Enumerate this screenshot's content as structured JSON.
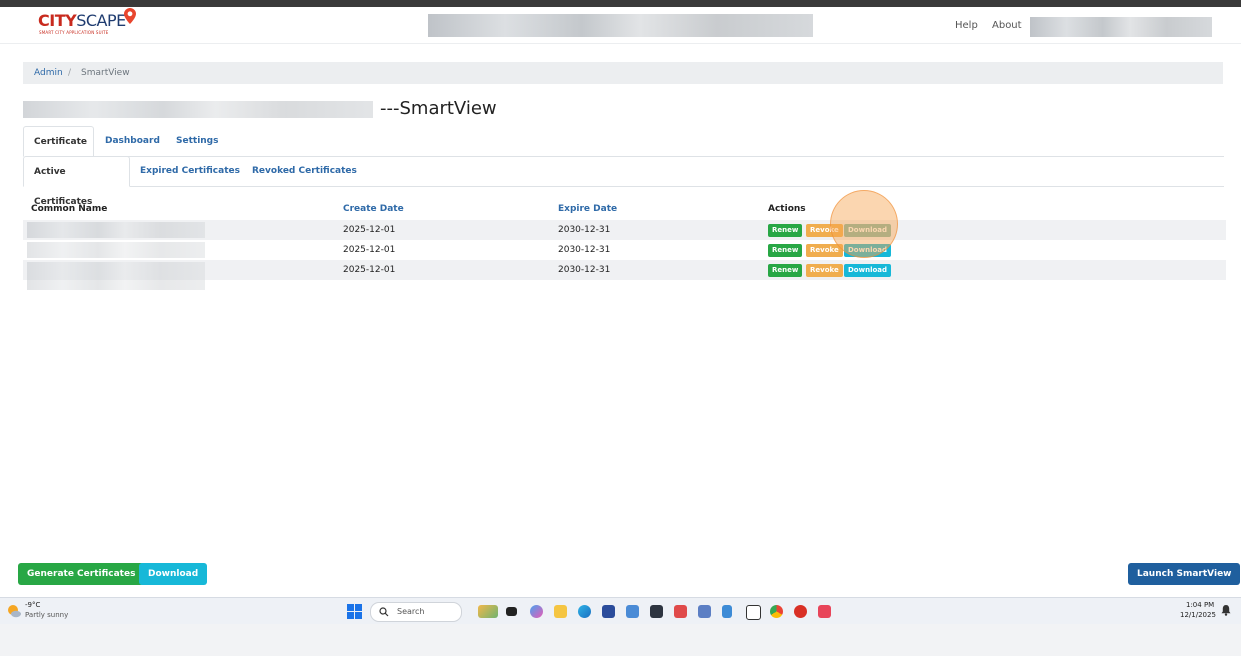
{
  "app": {
    "logo_main": "CITY",
    "logo_accent": "SCAPE",
    "logo_subtitle": "SMART CITY APPLICATION SUITE"
  },
  "navbar": {
    "help_label": "Help",
    "about_label": "About"
  },
  "breadcrumb": {
    "items": [
      "Admin",
      "SmartView"
    ],
    "separator": "/"
  },
  "page": {
    "title": "---SmartView"
  },
  "tabs": [
    {
      "label": "Certificate",
      "active": true
    },
    {
      "label": "Dashboard",
      "active": false
    },
    {
      "label": "Settings",
      "active": false
    }
  ],
  "subtabs": [
    {
      "label": "Active Certificates",
      "active": true
    },
    {
      "label": "Expired Certificates",
      "active": false
    },
    {
      "label": "Revoked Certificates",
      "active": false
    }
  ],
  "table": {
    "headers": [
      "Common Name",
      "Create Date",
      "Expire Date",
      "Actions"
    ],
    "rows": [
      {
        "create_date": "2025-12-01",
        "expire_date": "2030-12-31"
      },
      {
        "create_date": "2025-12-01",
        "expire_date": "2030-12-31"
      },
      {
        "create_date": "2025-12-01",
        "expire_date": "2030-12-31"
      }
    ],
    "actions": {
      "renew": "Renew",
      "revoke": "Revoke",
      "download": "Download"
    }
  },
  "footer": {
    "generate_label": "Generate Certificates",
    "download_label": "Download",
    "launch_label": "Launch SmartView"
  },
  "taskbar": {
    "weather_temp": "-9°C",
    "weather_desc": "Partly sunny",
    "search_label": "Search",
    "time": "1:04 PM",
    "date": "12/1/2025"
  },
  "colors": {
    "brand_red": "#c82a1e",
    "brand_navy": "#1f3c70",
    "link_blue": "#2f6aa8",
    "green": "#28a745",
    "orange": "#f0ad4e",
    "cyan": "#17b8d8",
    "launch_blue": "#1f5f9e"
  }
}
